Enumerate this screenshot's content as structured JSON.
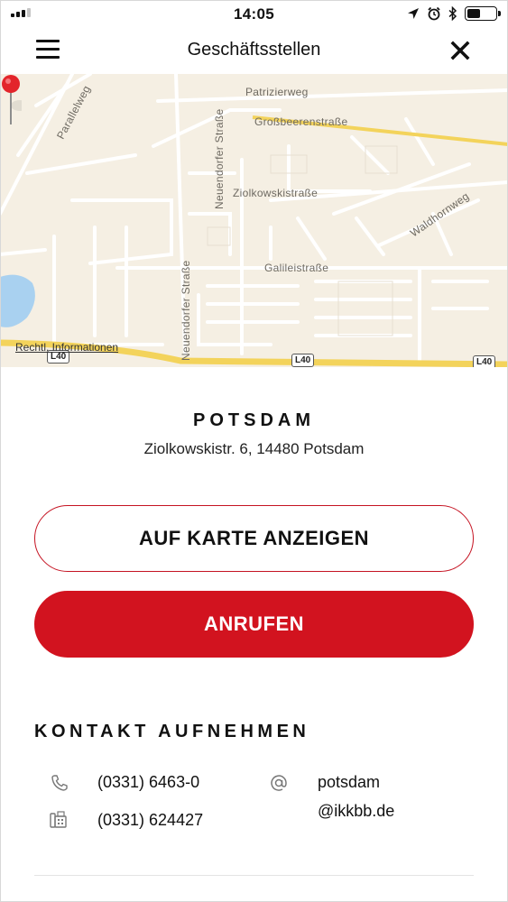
{
  "status_bar": {
    "time": "14:05",
    "icons": [
      "signal-icon",
      "location-arrow-icon",
      "alarm-icon",
      "bluetooth-icon",
      "battery-icon"
    ]
  },
  "nav": {
    "title": "Geschäftsstellen",
    "menu_icon": "hamburger-menu-icon",
    "close_icon": "close-icon"
  },
  "map": {
    "labels": {
      "patrizierweg": "Patrizierweg",
      "grossbeerenstrasse": "Großbeerenstraße",
      "parallelweg": "Parallelweg",
      "neuendorfer_upper": "Neuendorfer Straße",
      "neuendorfer_lower": "Neuendorfer Straße",
      "ziolkowskistrasse": "Ziolkowskistraße",
      "waldhornweg": "Waldhornweg",
      "galileistrasse": "Galileistraße"
    },
    "road_shields": [
      "L40",
      "L40",
      "L40"
    ],
    "legal_link": "Rechtl. Informationen",
    "pin_icon": "map-pin-icon",
    "colors": {
      "background": "#f5efe3",
      "road": "#ffffff",
      "major_road": "#f3d35b",
      "water": "#a9d1f0",
      "pin": "#e3252b"
    }
  },
  "office": {
    "name": "POTSDAM",
    "address": "Ziolkowskistr. 6, 14480 Potsdam"
  },
  "actions": {
    "show_on_map": "AUF KARTE ANZEIGEN",
    "call": "ANRUFEN",
    "accent_color": "#d2131f"
  },
  "contact": {
    "title": "KONTAKT AUFNEHMEN",
    "phone": "(0331) 6463-0",
    "fax": "(0331) 624427",
    "email_line1": "potsdam",
    "email_line2": "@ikkbb.de",
    "icons": [
      "phone-icon",
      "fax-icon",
      "at-sign-icon"
    ]
  }
}
